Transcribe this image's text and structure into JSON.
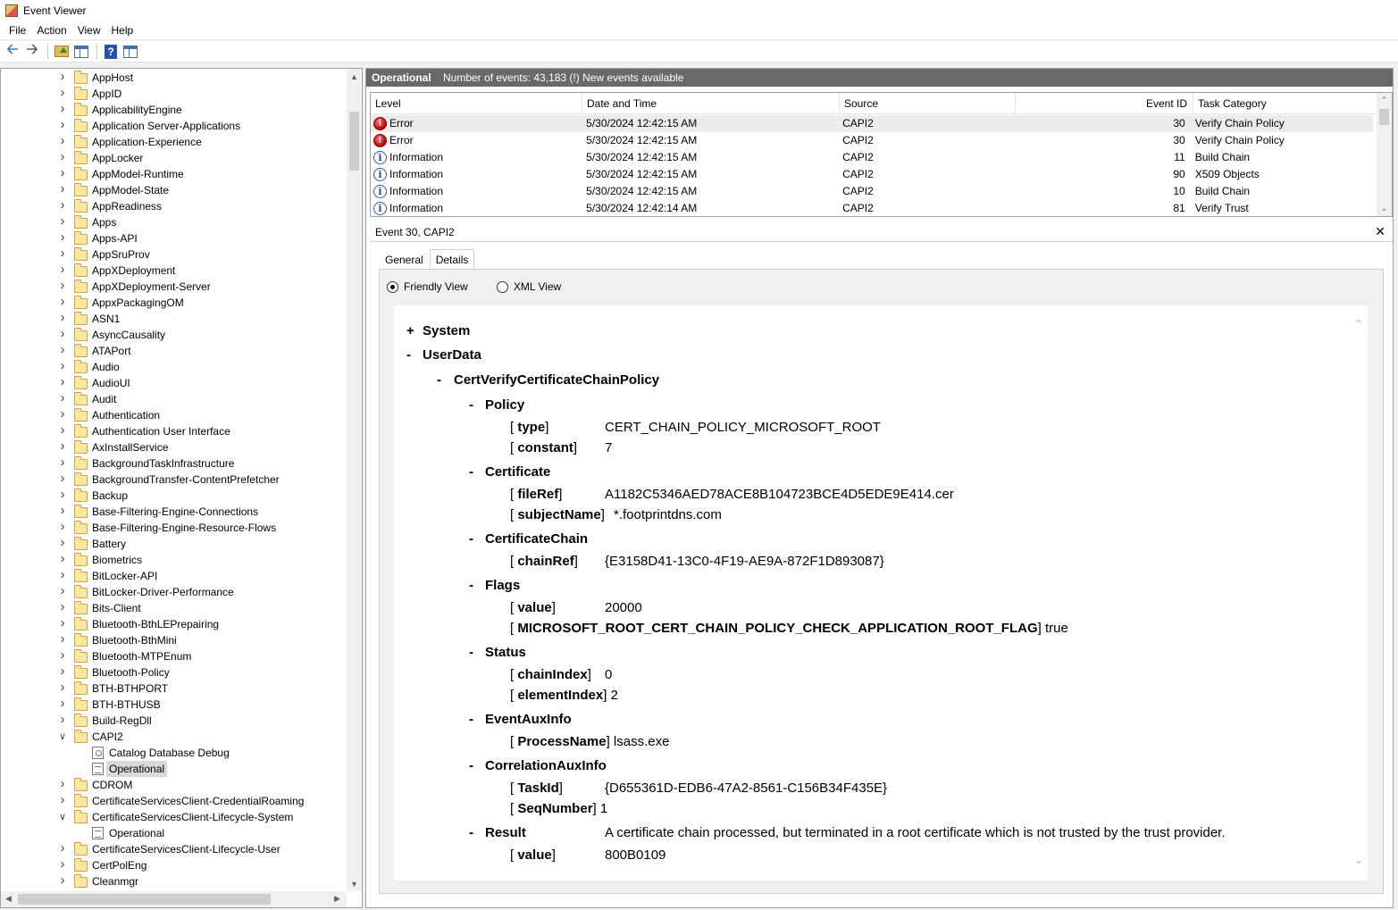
{
  "window": {
    "title": "Event Viewer"
  },
  "menu": [
    "File",
    "Action",
    "View",
    "Help"
  ],
  "toolbar": {
    "icons": [
      "back-arrow-icon",
      "forward-arrow-icon",
      "folder-up-icon",
      "show-tree-icon",
      "help-icon",
      "show-action-pane-icon"
    ]
  },
  "tree": {
    "items": [
      {
        "label": "AppHost",
        "type": "folder",
        "expanded": false
      },
      {
        "label": "AppID",
        "type": "folder",
        "expanded": false
      },
      {
        "label": "ApplicabilityEngine",
        "type": "folder",
        "expanded": false
      },
      {
        "label": "Application Server-Applications",
        "type": "folder",
        "expanded": false
      },
      {
        "label": "Application-Experience",
        "type": "folder",
        "expanded": false
      },
      {
        "label": "AppLocker",
        "type": "folder",
        "expanded": false
      },
      {
        "label": "AppModel-Runtime",
        "type": "folder",
        "expanded": false
      },
      {
        "label": "AppModel-State",
        "type": "folder",
        "expanded": false
      },
      {
        "label": "AppReadiness",
        "type": "folder",
        "expanded": false
      },
      {
        "label": "Apps",
        "type": "folder",
        "expanded": false
      },
      {
        "label": "Apps-API",
        "type": "folder",
        "expanded": false
      },
      {
        "label": "AppSruProv",
        "type": "folder",
        "expanded": false
      },
      {
        "label": "AppXDeployment",
        "type": "folder",
        "expanded": false
      },
      {
        "label": "AppXDeployment-Server",
        "type": "folder",
        "expanded": false
      },
      {
        "label": "AppxPackagingOM",
        "type": "folder",
        "expanded": false
      },
      {
        "label": "ASN1",
        "type": "folder",
        "expanded": false
      },
      {
        "label": "AsyncCausality",
        "type": "folder",
        "expanded": false
      },
      {
        "label": "ATAPort",
        "type": "folder",
        "expanded": false
      },
      {
        "label": "Audio",
        "type": "folder",
        "expanded": false
      },
      {
        "label": "AudioUI",
        "type": "folder",
        "expanded": false
      },
      {
        "label": "Audit",
        "type": "folder",
        "expanded": false
      },
      {
        "label": "Authentication",
        "type": "folder",
        "expanded": false
      },
      {
        "label": "Authentication User Interface",
        "type": "folder",
        "expanded": false
      },
      {
        "label": "AxInstallService",
        "type": "folder",
        "expanded": false
      },
      {
        "label": "BackgroundTaskInfrastructure",
        "type": "folder",
        "expanded": false
      },
      {
        "label": "BackgroundTransfer-ContentPrefetcher",
        "type": "folder",
        "expanded": false
      },
      {
        "label": "Backup",
        "type": "folder",
        "expanded": false
      },
      {
        "label": "Base-Filtering-Engine-Connections",
        "type": "folder",
        "expanded": false
      },
      {
        "label": "Base-Filtering-Engine-Resource-Flows",
        "type": "folder",
        "expanded": false
      },
      {
        "label": "Battery",
        "type": "folder",
        "expanded": false
      },
      {
        "label": "Biometrics",
        "type": "folder",
        "expanded": false
      },
      {
        "label": "BitLocker-API",
        "type": "folder",
        "expanded": false
      },
      {
        "label": "BitLocker-Driver-Performance",
        "type": "folder",
        "expanded": false
      },
      {
        "label": "Bits-Client",
        "type": "folder",
        "expanded": false
      },
      {
        "label": "Bluetooth-BthLEPrepairing",
        "type": "folder",
        "expanded": false
      },
      {
        "label": "Bluetooth-BthMini",
        "type": "folder",
        "expanded": false
      },
      {
        "label": "Bluetooth-MTPEnum",
        "type": "folder",
        "expanded": false
      },
      {
        "label": "Bluetooth-Policy",
        "type": "folder",
        "expanded": false
      },
      {
        "label": "BTH-BTHPORT",
        "type": "folder",
        "expanded": false
      },
      {
        "label": "BTH-BTHUSB",
        "type": "folder",
        "expanded": false
      },
      {
        "label": "Build-RegDll",
        "type": "folder",
        "expanded": false
      },
      {
        "label": "CAPI2",
        "type": "folder",
        "expanded": true
      },
      {
        "label": "Catalog Database Debug",
        "type": "debuglog",
        "child": true
      },
      {
        "label": "Operational",
        "type": "log",
        "child": true,
        "selected": true
      },
      {
        "label": "CDROM",
        "type": "folder",
        "expanded": false
      },
      {
        "label": "CertificateServicesClient-CredentialRoaming",
        "type": "folder",
        "expanded": false
      },
      {
        "label": "CertificateServicesClient-Lifecycle-System",
        "type": "folder",
        "expanded": true
      },
      {
        "label": "Operational",
        "type": "log",
        "child": true
      },
      {
        "label": "CertificateServicesClient-Lifecycle-User",
        "type": "folder",
        "expanded": false
      },
      {
        "label": "CertPolEng",
        "type": "folder",
        "expanded": false
      },
      {
        "label": "Cleanmgr",
        "type": "folder",
        "expanded": false
      }
    ]
  },
  "events_panel": {
    "log_name": "Operational",
    "event_count_text": "Number of events: 43,183 (!) New events available",
    "columns": [
      "Level",
      "Date and Time",
      "Source",
      "Event ID",
      "Task Category"
    ],
    "rows": [
      {
        "level": "Error",
        "icon": "error",
        "datetime": "5/30/2024 12:42:15 AM",
        "source": "CAPI2",
        "event_id": "30",
        "task": "Verify Chain Policy",
        "selected": true
      },
      {
        "level": "Error",
        "icon": "error",
        "datetime": "5/30/2024 12:42:15 AM",
        "source": "CAPI2",
        "event_id": "30",
        "task": "Verify Chain Policy"
      },
      {
        "level": "Information",
        "icon": "info",
        "datetime": "5/30/2024 12:42:15 AM",
        "source": "CAPI2",
        "event_id": "11",
        "task": "Build Chain"
      },
      {
        "level": "Information",
        "icon": "info",
        "datetime": "5/30/2024 12:42:15 AM",
        "source": "CAPI2",
        "event_id": "90",
        "task": "X509 Objects"
      },
      {
        "level": "Information",
        "icon": "info",
        "datetime": "5/30/2024 12:42:15 AM",
        "source": "CAPI2",
        "event_id": "10",
        "task": "Build Chain"
      },
      {
        "level": "Information",
        "icon": "info",
        "datetime": "5/30/2024 12:42:14 AM",
        "source": "CAPI2",
        "event_id": "81",
        "task": "Verify Trust"
      }
    ]
  },
  "detail": {
    "header": "Event 30, CAPI2",
    "close": "✕",
    "tabs": [
      "General",
      "Details"
    ],
    "active_tab": "Details",
    "views": {
      "friendly": "Friendly View",
      "xml": "XML View",
      "selected": "friendly"
    },
    "tree": {
      "system": "System",
      "userdata": "UserData",
      "root": "CertVerifyCertificateChainPolicy",
      "policy": {
        "label": "Policy",
        "type_key": "type",
        "type_val": "CERT_CHAIN_POLICY_MICROSOFT_ROOT",
        "constant_key": "constant",
        "constant_val": "7"
      },
      "certificate": {
        "label": "Certificate",
        "fileref_key": "fileRef",
        "fileref_val": "A1182C5346AED78ACE8B104723BCE4D5EDE9E414.cer",
        "subject_key": "subjectName",
        "subject_val": "*.footprintdns.com"
      },
      "chain": {
        "label": "CertificateChain",
        "chainref_key": "chainRef",
        "chainref_val": "{E3158D41-13C0-4F19-AE9A-872F1D893087}"
      },
      "flags": {
        "label": "Flags",
        "value_key": "value",
        "value_val": "20000",
        "flag_key": "MICROSOFT_ROOT_CERT_CHAIN_POLICY_CHECK_APPLICATION_ROOT_FLAG",
        "flag_val": "true"
      },
      "status": {
        "label": "Status",
        "chainindex_key": "chainIndex",
        "chainindex_val": "0",
        "elementindex_key": "elementIndex",
        "elementindex_val": "2"
      },
      "aux": {
        "label": "EventAuxInfo",
        "process_key": "ProcessName",
        "process_val": "lsass.exe"
      },
      "corr": {
        "label": "CorrelationAuxInfo",
        "taskid_key": "TaskId",
        "taskid_val": "{D655361D-EDB6-47A2-8561-C156B34F435E}",
        "seq_key": "SeqNumber",
        "seq_val": "1"
      },
      "result": {
        "label": "Result",
        "text": "A certificate chain processed, but terminated in a root certificate which is not trusted by the trust provider.",
        "value_key": "value",
        "value_val": "800B0109"
      }
    }
  }
}
